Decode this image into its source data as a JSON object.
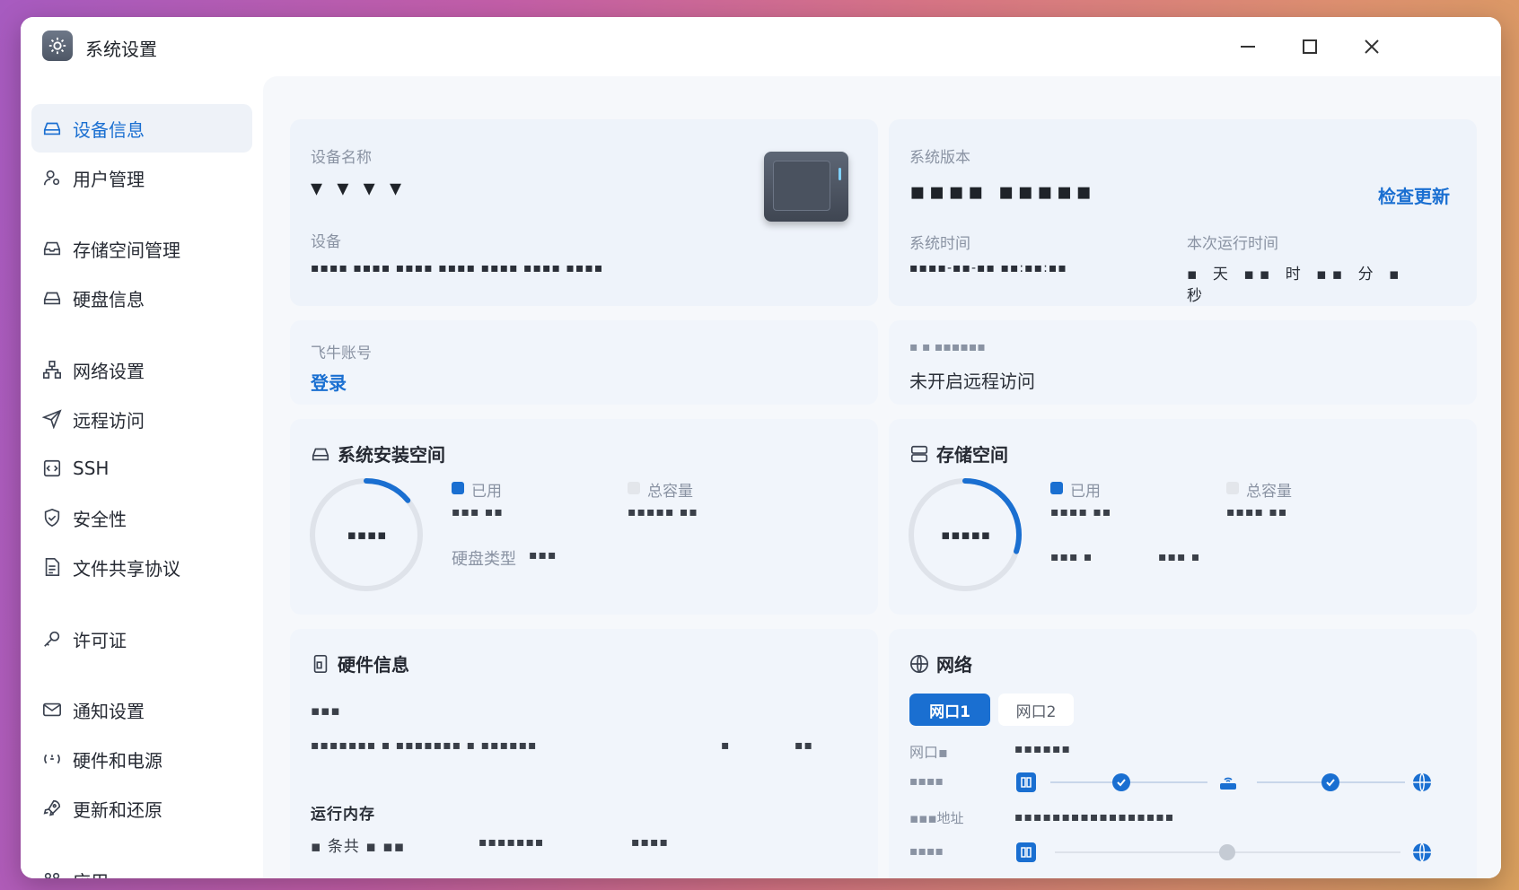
{
  "window": {
    "title": "系统设置"
  },
  "sidebar": {
    "items": [
      {
        "label": "设备信息",
        "icon": "hdd-icon",
        "active": true
      },
      {
        "label": "用户管理",
        "icon": "user-gear-icon"
      },
      {
        "label": "存储空间管理",
        "icon": "storage-icon"
      },
      {
        "label": "硬盘信息",
        "icon": "disk-icon"
      },
      {
        "label": "网络设置",
        "icon": "network-icon"
      },
      {
        "label": "远程访问",
        "icon": "send-icon"
      },
      {
        "label": "SSH",
        "icon": "terminal-icon"
      },
      {
        "label": "安全性",
        "icon": "shield-icon"
      },
      {
        "label": "文件共享协议",
        "icon": "document-icon"
      },
      {
        "label": "许可证",
        "icon": "key-icon"
      },
      {
        "label": "通知设置",
        "icon": "mail-icon"
      },
      {
        "label": "硬件和电源",
        "icon": "power-icon"
      },
      {
        "label": "更新和还原",
        "icon": "rocket-icon"
      },
      {
        "label": "应用",
        "icon": "apps-icon"
      }
    ]
  },
  "device": {
    "name_label": "设备名称",
    "name_value": "▾ ▾ ▾ ▾",
    "model_label": "设备",
    "model_value": "▪▪▪▪ ▪▪▪▪ ▪▪▪▪ ▪▪▪▪ ▪▪▪▪ ▪▪▪▪ ▪▪▪▪"
  },
  "system": {
    "version_label": "系统版本",
    "version_value": "▪▪▪▪ ▪▪▪▪▪",
    "check_update": "检查更新",
    "time_label": "系统时间",
    "time_value": "▪▪▪▪-▪▪-▪▪ ▪▪:▪▪:▪▪",
    "uptime_label": "本次运行时间",
    "uptime_value": "▪ 天 ▪▪ 时 ▪▪ 分 ▪",
    "uptime_suffix": "秒"
  },
  "account": {
    "label": "飞牛账号",
    "login": "登录"
  },
  "remote": {
    "label": "▪ ▪ ▪▪▪▪▪▪",
    "value": "未开启远程访问"
  },
  "sys_space": {
    "title": "系统安装空间",
    "used_label": "已用",
    "total_label": "总容量",
    "used_value": "▪▪▪ ▪▪",
    "total_value": "▪▪▪▪▪ ▪▪",
    "center": "▪▪▪▪",
    "disk_type_label": "硬盘类型",
    "disk_type_value": "▪▪▪",
    "used_fraction": 0.14
  },
  "storage": {
    "title": "存储空间",
    "used_label": "已用",
    "total_label": "总容量",
    "used_value": "▪▪▪▪ ▪▪",
    "total_value": "▪▪▪▪ ▪▪",
    "center": "▪▪▪▪▪",
    "extra1": "▪▪▪ ▪",
    "extra2": "▪▪▪ ▪",
    "used_fraction": 0.3
  },
  "hardware": {
    "title": "硬件信息",
    "cpu_label": "▪▪▪",
    "cpu_value": "▪▪▪▪▪▪▪ ▪ ▪▪▪▪▪▪▪ ▪ ▪▪▪▪▪▪",
    "cpu_extra1": "▪",
    "cpu_extra2": "▪▪",
    "memory_label": "运行内存",
    "memory_value": "▪ 条共 ▪ ▪▪",
    "memory_extra1": "▪▪▪▪▪▪▪",
    "memory_extra2": "▪▪▪▪"
  },
  "network": {
    "title": "网络",
    "tabs": [
      {
        "label": "网口1",
        "active": true
      },
      {
        "label": "网口2",
        "active": false
      }
    ],
    "port_label": "网口▪",
    "port_value": "▪▪▪▪▪▪",
    "row1_label": "▪▪▪▪",
    "row2_label": "▪▪▪地址",
    "row2_value": "▪▪▪▪▪▪▪▪▪▪▪▪▪▪▪▪▪",
    "row3_label": "▪▪▪▪"
  },
  "colors": {
    "accent": "#1a6fd1",
    "ring_track": "#dfe3ea",
    "card_bg": "#eef3fa"
  }
}
